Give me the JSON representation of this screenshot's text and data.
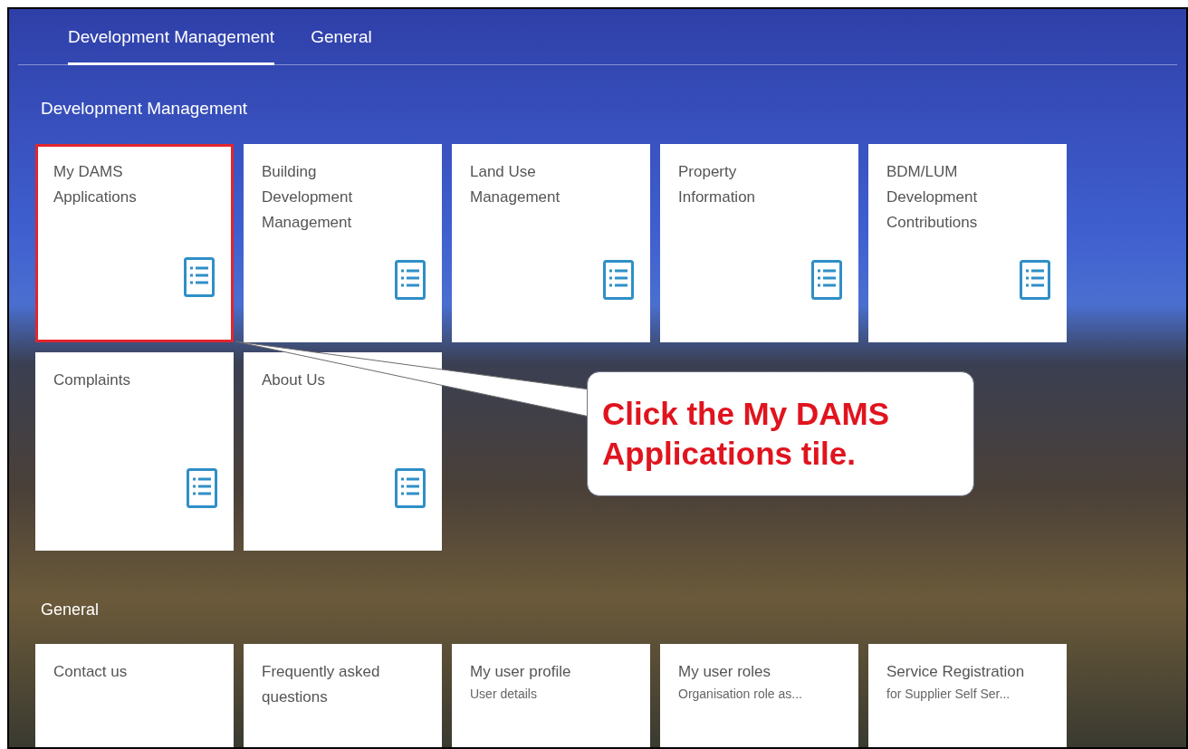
{
  "tabs": [
    {
      "label": "Development Management",
      "selected": true
    },
    {
      "label": "General",
      "selected": false
    }
  ],
  "groups": [
    {
      "title": "Development Management",
      "tiles": [
        {
          "title": "My DAMS Applications",
          "highlighted": true,
          "kind": "icon"
        },
        {
          "title": "Building Development Management",
          "highlighted": false,
          "kind": "icon"
        },
        {
          "title": "Land Use Management",
          "highlighted": false,
          "kind": "icon"
        },
        {
          "title": "Property Information",
          "highlighted": false,
          "kind": "icon"
        },
        {
          "title": "BDM/LUM Development Contributions",
          "highlighted": false,
          "kind": "icon"
        },
        {
          "title": "Complaints",
          "highlighted": false,
          "kind": "icon"
        },
        {
          "title": "About Us",
          "highlighted": false,
          "kind": "icon"
        }
      ]
    },
    {
      "title": "General",
      "tiles": [
        {
          "title": "Contact us",
          "highlighted": false
        },
        {
          "title": "Frequently asked questions",
          "highlighted": false
        },
        {
          "title": "My user profile",
          "subtitle": "User details",
          "highlighted": false
        },
        {
          "title": "My user roles",
          "subtitle": "Organisation role as...",
          "highlighted": false
        },
        {
          "title": "Service Registration",
          "subtitle": "for Supplier Self Ser...",
          "highlighted": false
        }
      ]
    }
  ],
  "callout": {
    "text": "Click the My DAMS Applications tile."
  }
}
